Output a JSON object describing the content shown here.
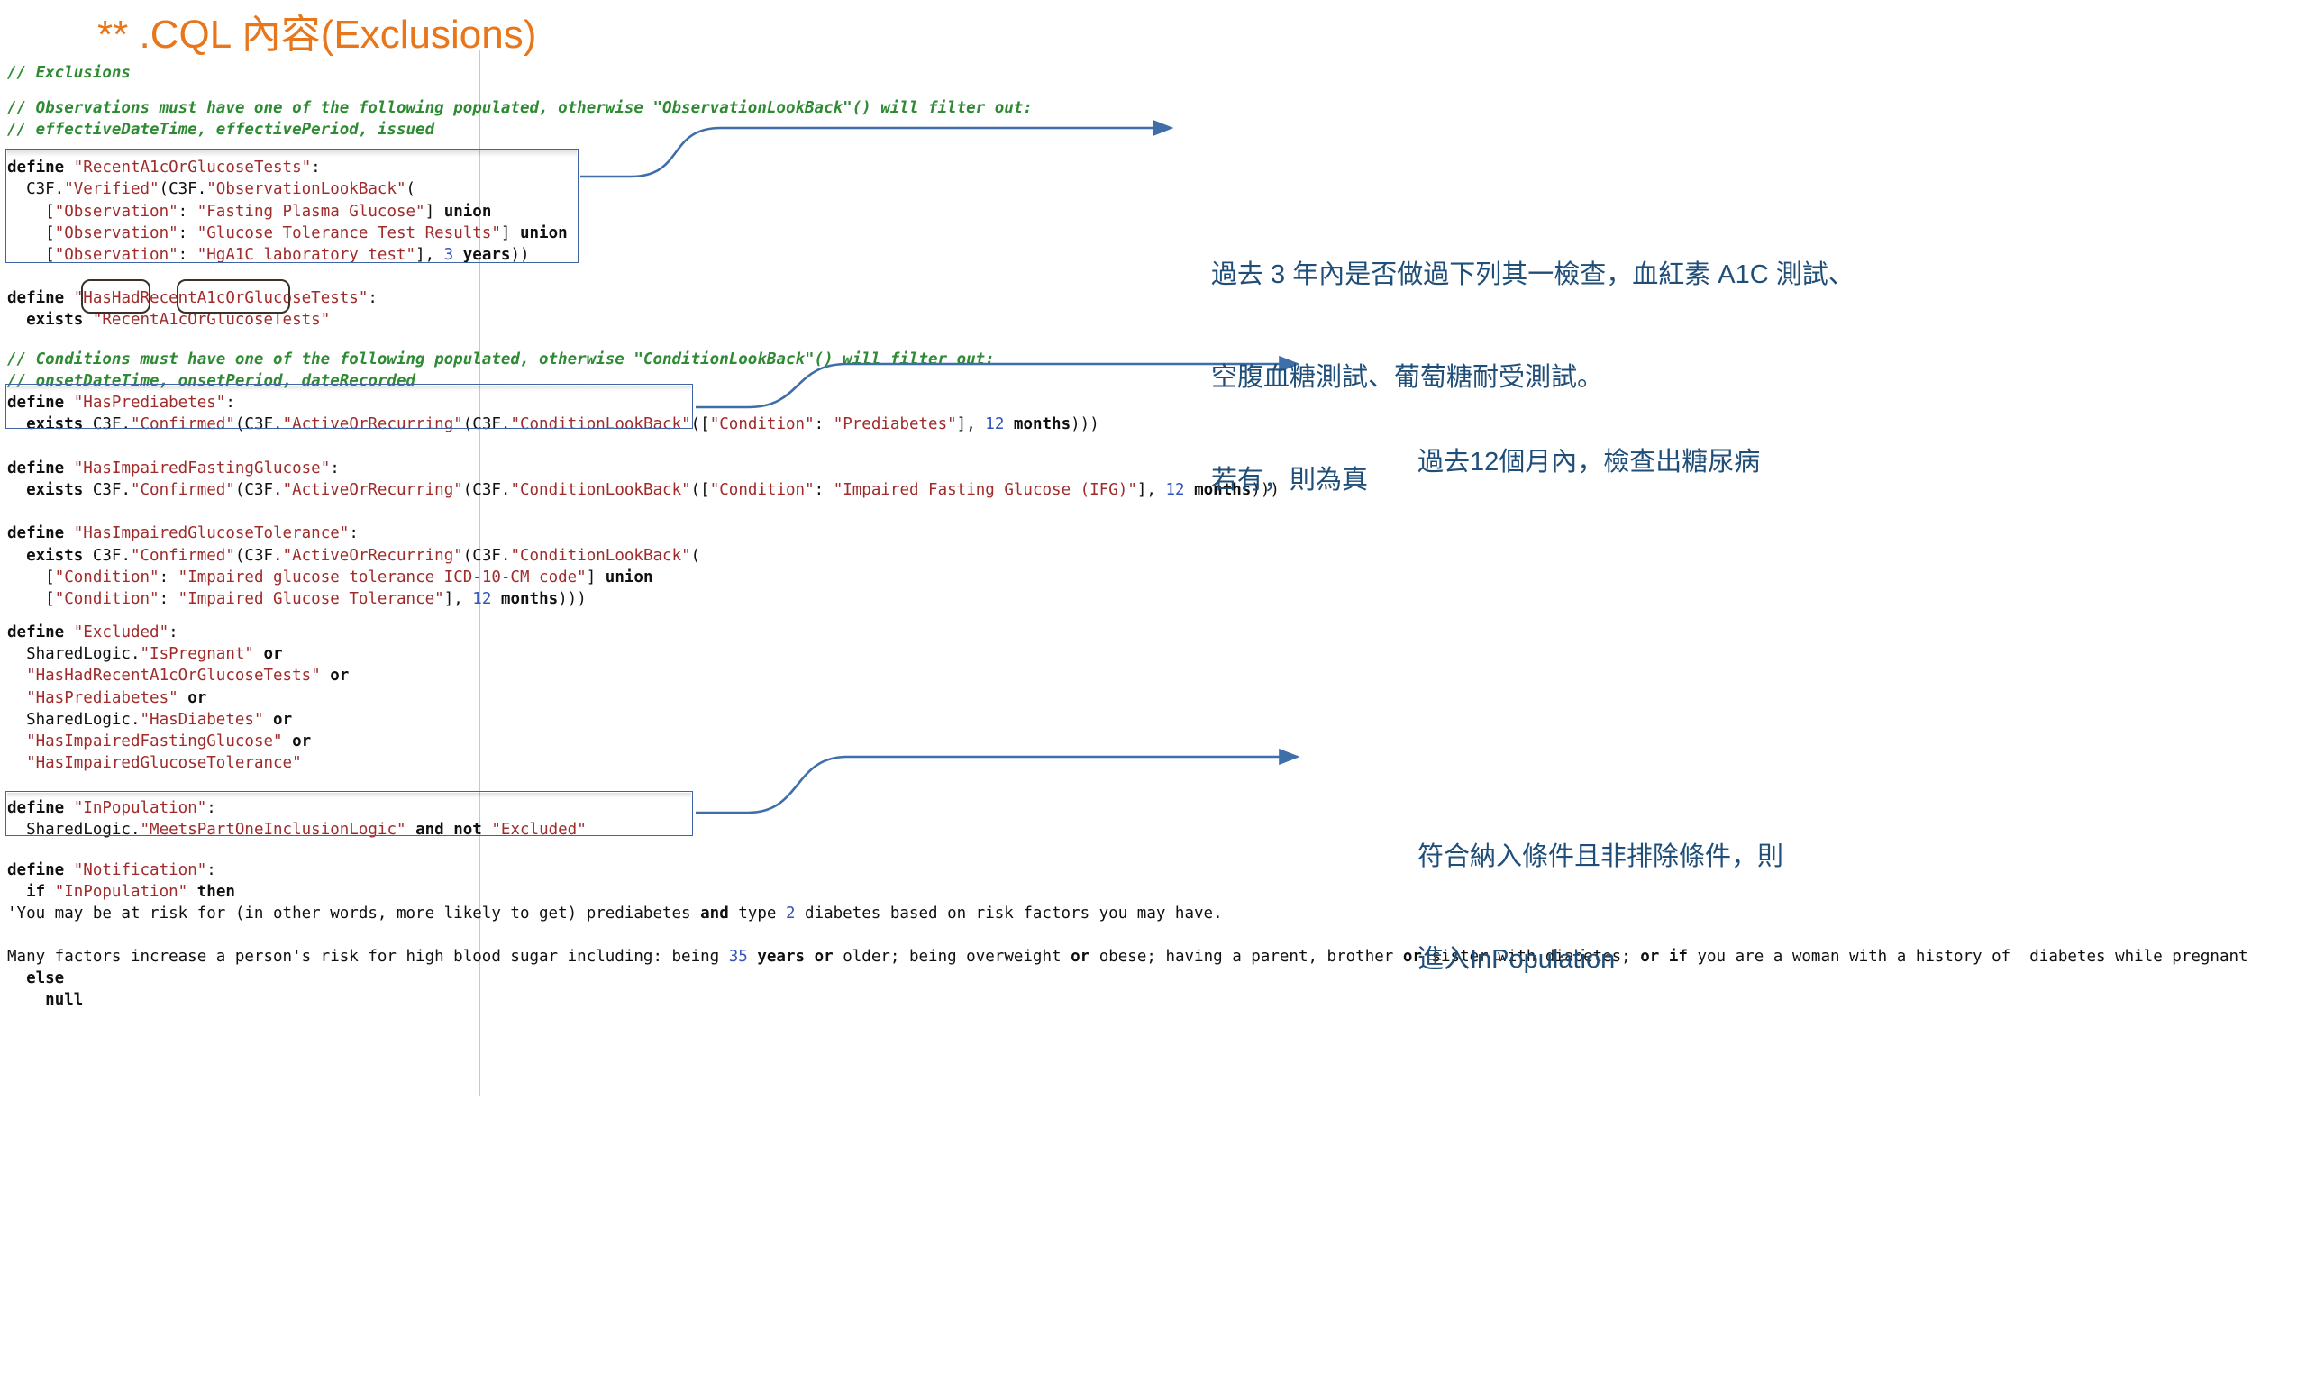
{
  "slide": {
    "title": "** .CQL 內容(Exclusions)"
  },
  "code": {
    "language": "cql",
    "lines": [
      "// Exclusions",
      "",
      "// Observations must have one of the following populated, otherwise \"ObservationLookBack\"() will filter out:",
      "// effectiveDateTime, effectivePeriod, issued",
      "",
      "define \"RecentA1cOrGlucoseTests\":",
      "  C3F.\"Verified\"(C3F.\"ObservationLookBack\"(",
      "    [\"Observation\": \"Fasting Plasma Glucose\"] union",
      "    [\"Observation\": \"Glucose Tolerance Test Results\"] union",
      "    [\"Observation\": \"HgA1C laboratory test\"], 3 years))",
      "",
      "define \"HasHadRecentA1cOrGlucoseTests\":",
      "  exists \"RecentA1cOrGlucoseTests\"",
      "",
      "// Conditions must have one of the following populated, otherwise \"ConditionLookBack\"() will filter out:",
      "// onsetDateTime, onsetPeriod, dateRecorded",
      "define \"HasPrediabetes\":",
      "  exists C3F.\"Confirmed\"(C3F.\"ActiveOrRecurring\"(C3F.\"ConditionLookBack\"([\"Condition\": \"Prediabetes\"], 12 months)))",
      "",
      "define \"HasImpairedFastingGlucose\":",
      "  exists C3F.\"Confirmed\"(C3F.\"ActiveOrRecurring\"(C3F.\"ConditionLookBack\"([\"Condition\": \"Impaired Fasting Glucose (IFG)\"], 12 months)))",
      "",
      "define \"HasImpairedGlucoseTolerance\":",
      "  exists C3F.\"Confirmed\"(C3F.\"ActiveOrRecurring\"(C3F.\"ConditionLookBack\"(",
      "    [\"Condition\": \"Impaired glucose tolerance ICD-10-CM code\"] union",
      "    [\"Condition\": \"Impaired Glucose Tolerance\"], 12 months)))",
      "",
      "define \"Excluded\":",
      "  SharedLogic.\"IsPregnant\" or",
      "  \"HasHadRecentA1cOrGlucoseTests\" or",
      "  \"HasPrediabetes\" or",
      "  SharedLogic.\"HasDiabetes\" or",
      "  \"HasImpairedFastingGlucose\" or",
      "  \"HasImpairedGlucoseTolerance\"",
      "",
      "define \"InPopulation\":",
      "  SharedLogic.\"MeetsPartOneInclusionLogic\" and not \"Excluded\"",
      "",
      "define \"Notification\":",
      "  if \"InPopulation\" then",
      "'You may be at risk for (in other words, more likely to get) prediabetes and type 2 diabetes based on risk factors you may have.",
      "",
      "Many factors increase a person's risk for high blood sugar including: being 35 years or older; being overweight or obese; having a parent, brother or sister with diabetes; or if you are a woman with a history of  diabetes while pregnant",
      "  else",
      "    null"
    ]
  },
  "highlights": [
    {
      "name": "confirmed-highlight",
      "label": "\"Confirmed\""
    },
    {
      "name": "active-or-recurring-highlight",
      "label": "\"ActiveOrRecurring\""
    }
  ],
  "notes": [
    {
      "id": "note-recent-tests",
      "lines": [
        "過去 3 年內是否做過下列其一檢查，血紅素 A1C 測試、",
        "空腹血糖測試、葡萄糖耐受測試。",
        "若有，則為真"
      ]
    },
    {
      "id": "note-prediabetes",
      "lines": [
        "過去12個月內，檢查出糖尿病"
      ]
    },
    {
      "id": "note-inpopulation",
      "lines": [
        "符合納入條件且非排除條件，則",
        "進入InPopulation"
      ]
    }
  ],
  "colors": {
    "title": "#E8761B",
    "note_text": "#1F4E79",
    "arrow": "#3F6FA8",
    "code_box_border": "#3F64A8",
    "comment": "#2E8B33",
    "string": "#A02B2B",
    "number": "#3355BB",
    "keyword": "#101010"
  }
}
